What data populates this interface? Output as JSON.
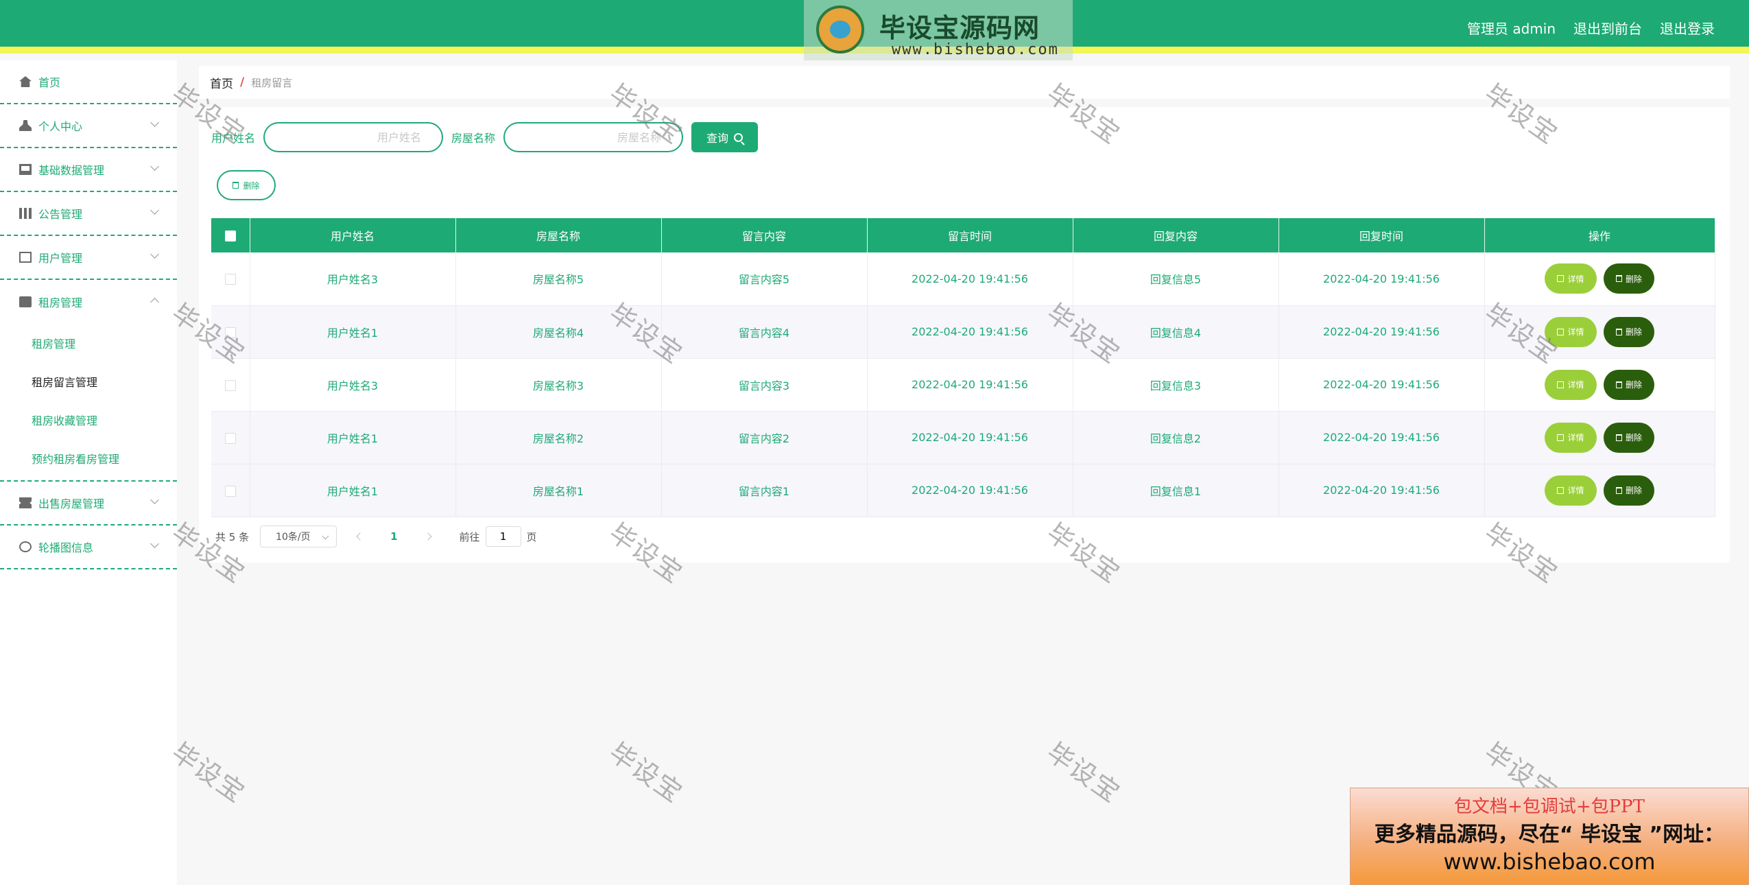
{
  "header": {
    "logo_title": "毕设宝源码网",
    "logo_url": "www.bishebao.com",
    "admin_label": "管理员 admin",
    "front_link": "退出到前台",
    "logout_link": "退出登录"
  },
  "sidebar": {
    "items": [
      {
        "label": "首页",
        "icon": "home-icon"
      },
      {
        "label": "个人中心",
        "icon": "user-icon"
      },
      {
        "label": "基础数据管理",
        "icon": "monitor-icon"
      },
      {
        "label": "公告管理",
        "icon": "grid-icon"
      },
      {
        "label": "用户管理",
        "icon": "id-card-icon"
      },
      {
        "label": "租房管理",
        "icon": "clipboard-icon"
      },
      {
        "label": "出售房屋管理",
        "icon": "ticket-icon"
      },
      {
        "label": "轮播图信息",
        "icon": "aim-icon"
      }
    ],
    "sub_items": [
      "租房管理",
      "租房留言管理",
      "租房收藏管理",
      "预约租房看房管理"
    ]
  },
  "breadcrumb": {
    "home": "首页",
    "separator": "/",
    "current": "租房留言"
  },
  "search": {
    "user_label": "用户姓名",
    "user_placeholder": "用户姓名",
    "house_label": "房屋名称",
    "house_placeholder": "房屋名称",
    "query_button": "查询"
  },
  "toolbar": {
    "delete_label": "删除"
  },
  "table": {
    "headers": [
      "用户姓名",
      "房屋名称",
      "留言内容",
      "留言时间",
      "回复内容",
      "回复时间",
      "操作"
    ],
    "detail_label": "详情",
    "delete_label": "删除",
    "rows": [
      {
        "user": "用户姓名3",
        "house": "房屋名称5",
        "content": "留言内容5",
        "time": "2022-04-20 19:41:56",
        "reply": "回复信息5",
        "reply_time": "2022-04-20 19:41:56"
      },
      {
        "user": "用户姓名1",
        "house": "房屋名称4",
        "content": "留言内容4",
        "time": "2022-04-20 19:41:56",
        "reply": "回复信息4",
        "reply_time": "2022-04-20 19:41:56"
      },
      {
        "user": "用户姓名3",
        "house": "房屋名称3",
        "content": "留言内容3",
        "time": "2022-04-20 19:41:56",
        "reply": "回复信息3",
        "reply_time": "2022-04-20 19:41:56"
      },
      {
        "user": "用户姓名1",
        "house": "房屋名称2",
        "content": "留言内容2",
        "time": "2022-04-20 19:41:56",
        "reply": "回复信息2",
        "reply_time": "2022-04-20 19:41:56"
      },
      {
        "user": "用户姓名1",
        "house": "房屋名称1",
        "content": "留言内容1",
        "time": "2022-04-20 19:41:56",
        "reply": "回复信息1",
        "reply_time": "2022-04-20 19:41:56"
      }
    ]
  },
  "pagination": {
    "total": "共 5 条",
    "page_size": "10条/页",
    "current_page": "1",
    "goto_label": "前往",
    "goto_value": "1",
    "page_suffix": "页"
  },
  "watermark": "毕设宝",
  "ad": {
    "line1": "包文档+包调试+包PPT",
    "line2": "更多精品源码，尽在“ 毕设宝 ”网址：",
    "line3": "www.bishebao.com"
  },
  "colors": {
    "primary": "#1eaa75",
    "accent_yellow": "#f3f654",
    "detail_button": "#9bcf3a",
    "delete_button": "#2b5e0c"
  }
}
